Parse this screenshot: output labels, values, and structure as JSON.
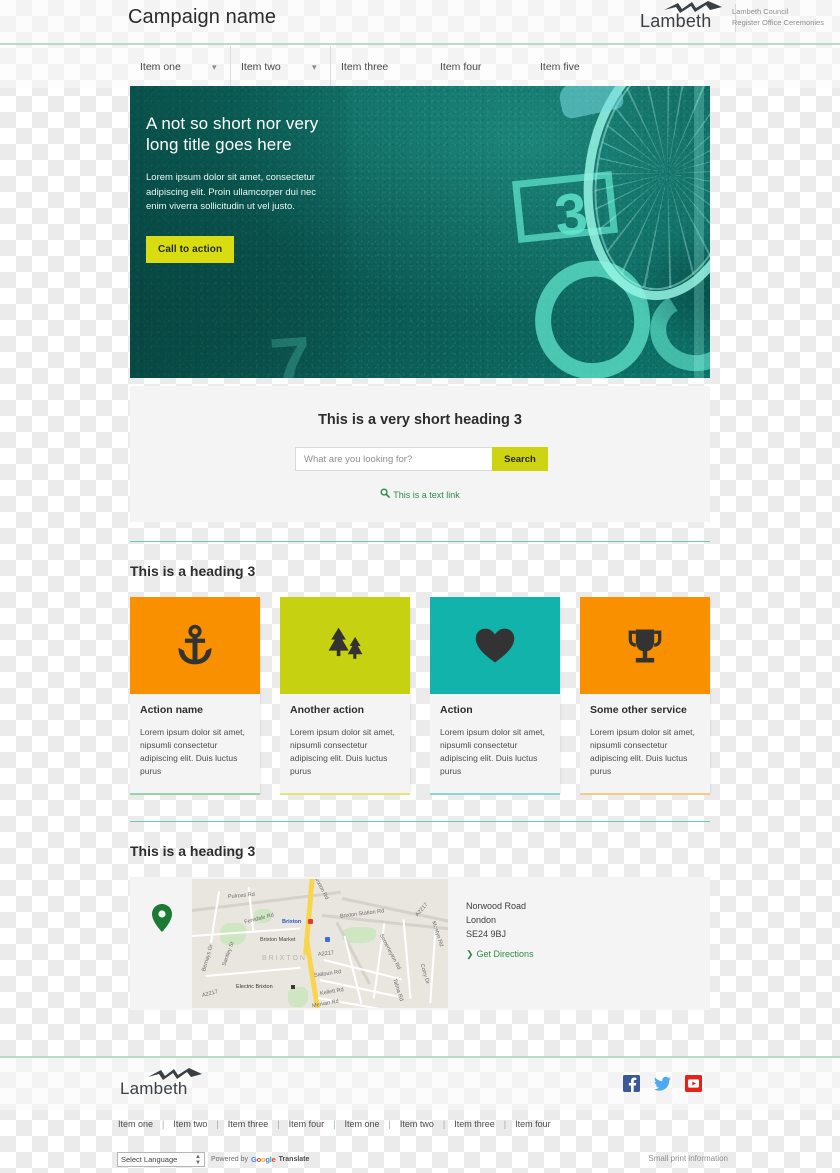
{
  "header": {
    "campaign_name": "Campaign name",
    "brand_word": "Lambeth",
    "brand_sub_line1": "Lambeth Council",
    "brand_sub_line2": "Register Office Ceremonies"
  },
  "nav": {
    "items": [
      {
        "label": "Item one",
        "has_chevron": true
      },
      {
        "label": "Item two",
        "has_chevron": true
      },
      {
        "label": "Item three",
        "has_chevron": false
      },
      {
        "label": "Item four",
        "has_chevron": false
      },
      {
        "label": "Item five",
        "has_chevron": false
      }
    ]
  },
  "hero": {
    "title": "A not so short nor very long title goes here",
    "body": "Lorem ipsum dolor sit amet, consectetur adipiscing elit. Proin ullamcorper dui nec enim viverra sollicitudin ut vel justo.",
    "cta_label": "Call to action",
    "cta_color": "#d8dc10",
    "image_alt": "Bicycle wheel on a teal-tinted cycle lane marked with the number 3"
  },
  "search_panel": {
    "heading": "This is a very short heading 3",
    "input_placeholder": "What are you looking for?",
    "input_value": "",
    "button_label": "Search",
    "button_color": "#ced411",
    "text_link": "This is a text link",
    "text_link_color": "#2e8b46"
  },
  "cards_section": {
    "heading": "This is a heading 3",
    "cards": [
      {
        "title": "Action name",
        "body": "Lorem ipsum dolor sit amet, nipsumli consectetur adipiscing elit. Duis luctus purus",
        "tile_color": "#f99000",
        "underline_color": "#9ad2ac",
        "icon": "anchor-icon"
      },
      {
        "title": "Another action",
        "body": "Lorem ipsum dolor sit amet, nipsumli consectetur adipiscing elit. Duis luctus purus",
        "tile_color": "#c6d211",
        "underline_color": "#e3e47a",
        "icon": "trees-icon"
      },
      {
        "title": "Action",
        "body": "Lorem ipsum dolor sit amet, nipsumli consectetur adipiscing elit. Duis luctus purus",
        "tile_color": "#11b3ab",
        "underline_color": "#8ed6d2",
        "icon": "heart-icon"
      },
      {
        "title": "Some other service",
        "body": "Lorem ipsum dolor sit amet, nipsumli consectetur adipiscing elit. Duis luctus purus",
        "tile_color": "#f99000",
        "underline_color": "#f5c98a",
        "icon": "trophy-icon"
      }
    ]
  },
  "map_section": {
    "heading": "This is a heading 3",
    "address_line1": "Norwood Road",
    "address_line2": "London",
    "address_line3": "SE24 9BJ",
    "directions_label": "Get Directions",
    "pin_color": "#1b7a33",
    "map_labels": {
      "place_brixton": "Brixton",
      "place_brixton_market": "Brixton Market",
      "place_electric_brixton": "Electric Brixton",
      "area_label": "BRIXTON",
      "roads": [
        "Pulross Rd",
        "Ferndale Rd",
        "Brixton Station Rd",
        "Brixton Rd",
        "A2217",
        "Mostyn Rd",
        "Somerleyton Rd",
        "Saltoun Rd",
        "Kellett Rd",
        "Mervan Rd",
        "Santley St",
        "Corry Dr",
        "Talma Rd",
        "Bernays Gr"
      ]
    }
  },
  "footer": {
    "brand_word": "Lambeth",
    "social": [
      {
        "name": "facebook-icon",
        "color": "#3b5998"
      },
      {
        "name": "twitter-icon",
        "color": "#4eaaf0"
      },
      {
        "name": "youtube-icon",
        "color": "#e62117"
      }
    ],
    "links": [
      "Item one",
      "Item two",
      "Item three",
      "Item four",
      "Item one",
      "Item two",
      "Item three",
      "Item four"
    ],
    "translate": {
      "select_label": "Select Language",
      "powered_by": "Powered by",
      "google": "Google",
      "translate_word": "Translate"
    },
    "small_print": "Small print information"
  }
}
